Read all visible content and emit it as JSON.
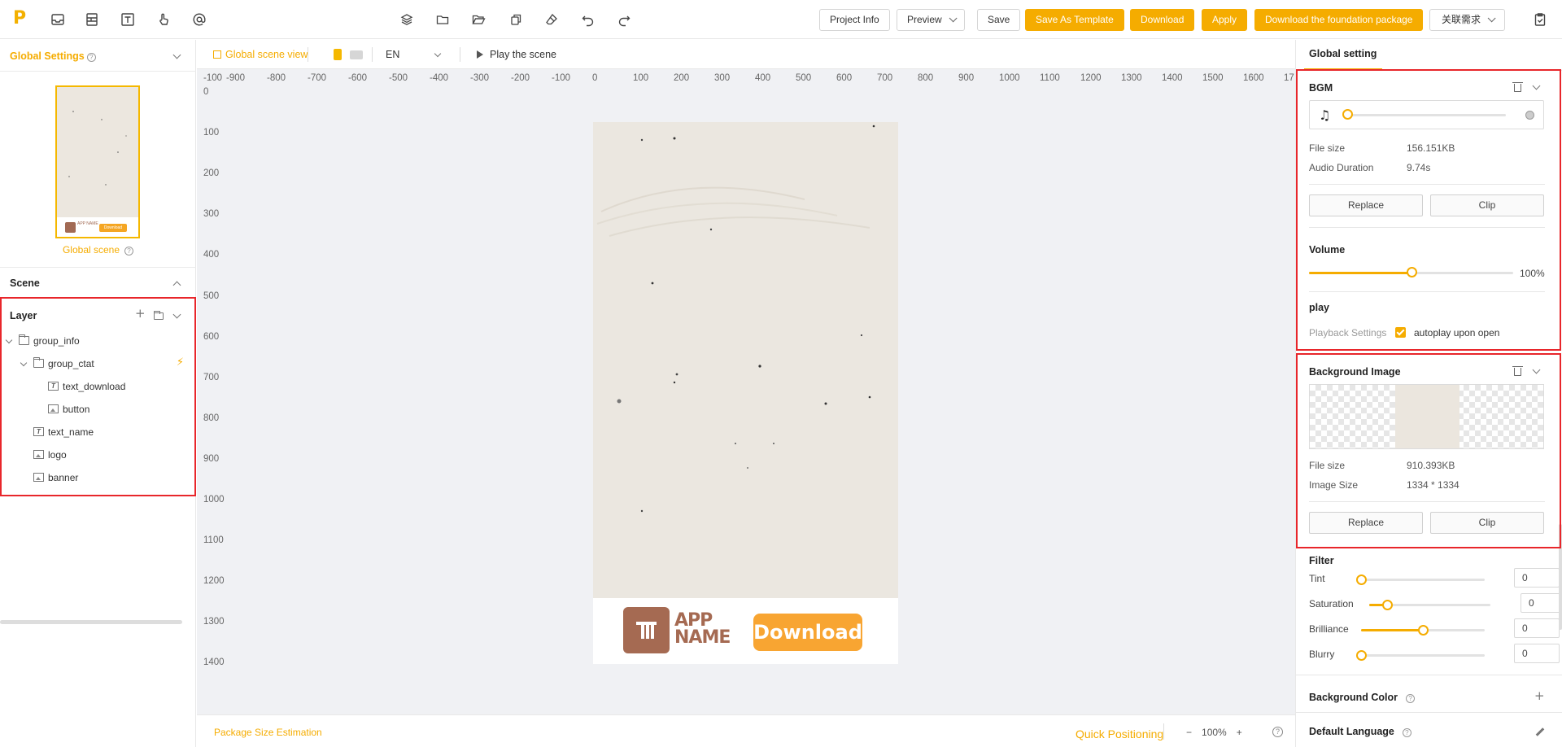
{
  "topbar": {
    "logo": "P",
    "buttons": {
      "project_info": "Project Info",
      "preview": "Preview",
      "save": "Save",
      "save_as_template": "Save As Template",
      "download": "Download",
      "apply": "Apply",
      "download_foundation": "Download the foundation package",
      "related_requirements": "关联需求"
    },
    "colors": {
      "accent": "#f5ac00"
    }
  },
  "left": {
    "global_settings": "Global Settings",
    "global_scene": "Global scene",
    "thumb_app_name": "APP NAME",
    "thumb_download": "Download",
    "scene_title": "Scene",
    "layer_title": "Layer",
    "layers": [
      {
        "name": "group_info",
        "type": "folder",
        "level": 0,
        "expanded": true
      },
      {
        "name": "group_ctat",
        "type": "folder",
        "level": 1,
        "expanded": true
      },
      {
        "name": "text_download",
        "type": "text",
        "level": 2
      },
      {
        "name": "button",
        "type": "image",
        "level": 2
      },
      {
        "name": "text_name",
        "type": "text",
        "level": 1
      },
      {
        "name": "logo",
        "type": "image",
        "level": 1
      },
      {
        "name": "banner",
        "type": "image",
        "level": 1
      }
    ]
  },
  "canvas": {
    "global_scene_view": "Global scene view",
    "language": "EN",
    "play_scene": "Play the scene",
    "ruler_x": [
      "-100",
      "-900",
      "-800",
      "-700",
      "-600",
      "-500",
      "-400",
      "-300",
      "-200",
      "-100",
      "0",
      "100",
      "200",
      "300",
      "400",
      "500",
      "600",
      "700",
      "800",
      "900",
      "1000",
      "1100",
      "1200",
      "1300",
      "1400",
      "1500",
      "1600",
      "17"
    ],
    "ruler_y": [
      "0",
      "100",
      "200",
      "300",
      "400",
      "500",
      "600",
      "700",
      "800",
      "900",
      "1000",
      "1100",
      "1200",
      "1300",
      "1400"
    ],
    "app_name_line1": "APP",
    "app_name_line2": "NAME",
    "download_button": "Download",
    "package_size": "Package Size Estimation",
    "quick_positioning": "Quick Positioning",
    "zoom_minus": "−",
    "zoom_level": "100%",
    "zoom_plus": "+"
  },
  "right": {
    "tab": "Global setting",
    "bgm": {
      "title": "BGM",
      "file_size_label": "File size",
      "file_size": "156.151KB",
      "duration_label": "Audio Duration",
      "duration": "9.74s",
      "replace": "Replace",
      "clip": "Clip",
      "playback_progress": 0
    },
    "volume": {
      "title": "Volume",
      "value": "100%",
      "level": 0.5
    },
    "play": {
      "title": "play",
      "settings_label": "Playback Settings",
      "autoplay_label": "autoplay upon open",
      "autoplay_checked": true
    },
    "background_image": {
      "title": "Background Image",
      "file_size_label": "File size",
      "file_size": "910.393KB",
      "image_size_label": "Image Size",
      "image_size": "1334 * 1334",
      "replace": "Replace",
      "clip": "Clip"
    },
    "filter": {
      "title": "Filter",
      "items": [
        {
          "label": "Tint",
          "value": "0",
          "level": 0
        },
        {
          "label": "Saturation",
          "value": "0",
          "level": 0.15
        },
        {
          "label": "Brilliance",
          "value": "0",
          "level": 0.5
        },
        {
          "label": "Blurry",
          "value": "0",
          "level": 0
        }
      ]
    },
    "background_color": "Background Color",
    "default_language": "Default Language"
  }
}
